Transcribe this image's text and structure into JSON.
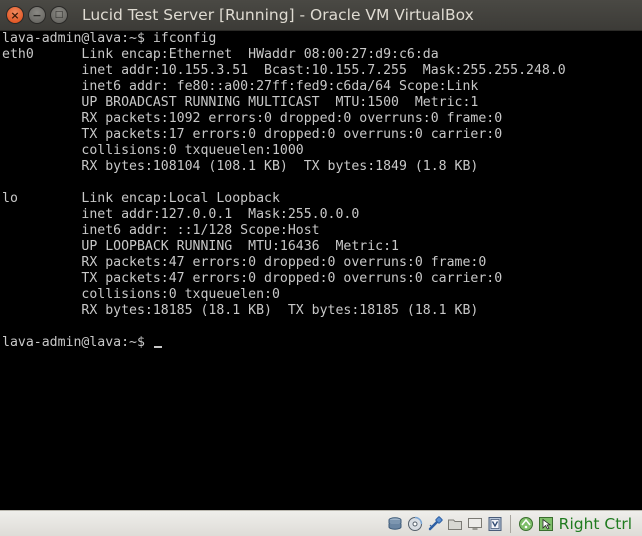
{
  "window": {
    "title": "Lucid Test Server [Running] - Oracle VM VirtualBox",
    "controls": {
      "close_glyph": "×",
      "minimize_glyph": "−",
      "maximize_glyph": "□"
    }
  },
  "terminal": {
    "lines": [
      "lava-admin@lava:~$ ifconfig",
      "eth0      Link encap:Ethernet  HWaddr 08:00:27:d9:c6:da",
      "          inet addr:10.155.3.51  Bcast:10.155.7.255  Mask:255.255.248.0",
      "          inet6 addr: fe80::a00:27ff:fed9:c6da/64 Scope:Link",
      "          UP BROADCAST RUNNING MULTICAST  MTU:1500  Metric:1",
      "          RX packets:1092 errors:0 dropped:0 overruns:0 frame:0",
      "          TX packets:17 errors:0 dropped:0 overruns:0 carrier:0",
      "          collisions:0 txqueuelen:1000",
      "          RX bytes:108104 (108.1 KB)  TX bytes:1849 (1.8 KB)",
      "",
      "lo        Link encap:Local Loopback",
      "          inet addr:127.0.0.1  Mask:255.0.0.0",
      "          inet6 addr: ::1/128 Scope:Host",
      "          UP LOOPBACK RUNNING  MTU:16436  Metric:1",
      "          RX packets:47 errors:0 dropped:0 overruns:0 frame:0",
      "          TX packets:47 errors:0 dropped:0 overruns:0 carrier:0",
      "          collisions:0 txqueuelen:0",
      "          RX bytes:18185 (18.1 KB)  TX bytes:18185 (18.1 KB)",
      "",
      "lava-admin@lava:~$ "
    ],
    "text_color": "#c8c8c8",
    "background": "#000000"
  },
  "statusbar": {
    "icons": [
      "hard-disk-icon",
      "optical-drive-icon",
      "usb-icon",
      "shared-folders-icon",
      "display-icon",
      "video-capture-icon",
      "network-icon",
      "mouse-integration-icon"
    ],
    "host_key_label": "Right Ctrl",
    "host_key_color": "#1f7b1f"
  }
}
